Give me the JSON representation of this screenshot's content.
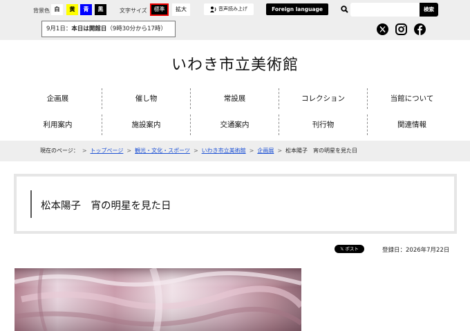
{
  "topbar": {
    "bg_label": "背景色",
    "bg_colors": [
      {
        "label": "白",
        "color": "#ffffff"
      },
      {
        "label": "黄",
        "color": "#ffff00"
      },
      {
        "label": "青",
        "color": "#0000ff"
      },
      {
        "label": "黒",
        "color": "#000000"
      }
    ],
    "size_label": "文字サイズ",
    "size_standard": "標準",
    "size_large": "拡大",
    "voice_label": "音声読み上げ",
    "foreign_label": "Foreign language",
    "search_button": "検索",
    "search_value": ""
  },
  "notice": {
    "date": "9月1日：",
    "bold": "本日は開館日",
    "hours": "（9時30分から17時）"
  },
  "site": {
    "title": "いわき市立美術館"
  },
  "nav": {
    "row1": [
      "企画展",
      "催し物",
      "常設展",
      "コレクション",
      "当館について"
    ],
    "row2": [
      "利用案内",
      "施設案内",
      "交通案内",
      "刊行物",
      "関連情報"
    ]
  },
  "breadcrumb": {
    "prefix": "現在のページ：",
    "links": [
      "トップページ",
      "観光・文化・スポーツ",
      "いわき市立美術館",
      "企画展"
    ],
    "current": "松本陽子　宵の明星を見た日"
  },
  "page": {
    "title": "松本陽子　宵の明星を見た日",
    "post_label": "ポスト",
    "registered": "登録日：2026年7月22日"
  },
  "colors": {
    "accent_red": "#e00000",
    "link_blue": "#1a4fd4",
    "bar_gray": "#eeeeee"
  }
}
